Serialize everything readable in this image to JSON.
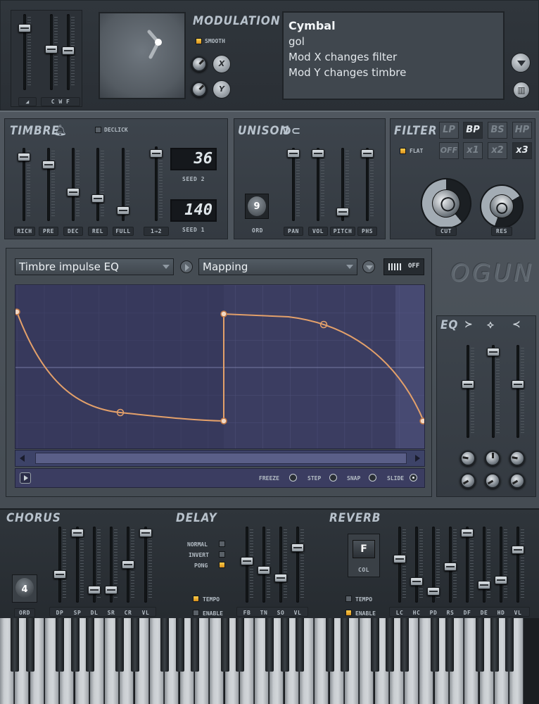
{
  "modulation": {
    "title": "MODULATION",
    "smooth_label": "SMOOTH",
    "x_label": "X",
    "y_label": "Y",
    "left_labels": [
      "◢",
      "C W F"
    ]
  },
  "info": {
    "lines": [
      "Cymbal",
      "gol",
      "Mod X changes filter",
      "Mod Y changes timbre"
    ]
  },
  "timbre": {
    "title": "TIMBRE",
    "declick_label": "DECLICK",
    "sliders": [
      {
        "label": "RICH",
        "level": 0.92
      },
      {
        "label": "PRE",
        "level": 0.8
      },
      {
        "label": "DEC",
        "level": 0.38
      },
      {
        "label": "REL",
        "level": 0.28
      },
      {
        "label": "FULL",
        "level": 0.1
      }
    ],
    "mix_label": "1→2",
    "mix_level": 0.96,
    "seed2_value": "36",
    "seed2_label": "SEED 2",
    "seed1_value": "140",
    "seed1_label": "SEED 1"
  },
  "unison": {
    "title": "UNISON",
    "ord_value": "9",
    "ord_label": "ORD",
    "sliders": [
      {
        "label": "PAN",
        "level": 0.98
      },
      {
        "label": "VOL",
        "level": 0.98
      },
      {
        "label": "PITCH",
        "level": 0.08
      },
      {
        "label": "PHS",
        "level": 0.98
      }
    ]
  },
  "filter": {
    "title": "FILTER",
    "types": [
      "LP",
      "BP",
      "BS",
      "HP"
    ],
    "active_type": "BP",
    "flat_label": "FLAT",
    "off_label": "OFF",
    "multipliers": [
      "x1",
      "x2",
      "x3"
    ],
    "active_multiplier": "x3",
    "cut_label": "CUT",
    "res_label": "RES"
  },
  "envelope": {
    "target_select": "Timbre impulse EQ",
    "mapping_select": "Mapping",
    "off_label": "OFF",
    "freeze_label": "FREEZE",
    "step_label": "STEP",
    "snap_label": "SNAP",
    "slide_label": "SLIDE",
    "curve_color": "#e3a06a"
  },
  "logo": "OGUN",
  "eq": {
    "title": "EQ",
    "levels": [
      0.58,
      0.97,
      0.58
    ]
  },
  "chorus": {
    "title": "CHORUS",
    "ord_value": "4",
    "ord_label": "ORD",
    "sliders": [
      {
        "label": "DP",
        "level": 0.35
      },
      {
        "label": "SP",
        "level": 0.97
      },
      {
        "label": "DL",
        "level": 0.12
      },
      {
        "label": "SR",
        "level": 0.12
      },
      {
        "label": "CR",
        "level": 0.5
      },
      {
        "label": "VL",
        "level": 0.97
      }
    ]
  },
  "delay": {
    "title": "DELAY",
    "modes": [
      {
        "label": "NORMAL",
        "state": "dim"
      },
      {
        "label": "INVERT",
        "state": "dim"
      },
      {
        "label": "PONG",
        "state": "on"
      }
    ],
    "tempo_label": "TEMPO",
    "enable_label": "ENABLE",
    "sliders": [
      {
        "label": "FB",
        "level": 0.55
      },
      {
        "label": "TN",
        "level": 0.42
      },
      {
        "label": "SO",
        "level": 0.3
      },
      {
        "label": "VL",
        "level": 0.75
      }
    ]
  },
  "reverb": {
    "title": "REVERB",
    "col_value": "F",
    "col_label": "COL",
    "tempo_label": "TEMPO",
    "enable_label": "ENABLE",
    "sliders": [
      {
        "label": "LC",
        "level": 0.58
      },
      {
        "label": "HC",
        "level": 0.25
      },
      {
        "label": "PD",
        "level": 0.1
      },
      {
        "label": "RS",
        "level": 0.47
      },
      {
        "label": "DF",
        "level": 0.97
      },
      {
        "label": "DE",
        "level": 0.2
      },
      {
        "label": "HD",
        "level": 0.27
      },
      {
        "label": "VL",
        "level": 0.72
      }
    ]
  }
}
